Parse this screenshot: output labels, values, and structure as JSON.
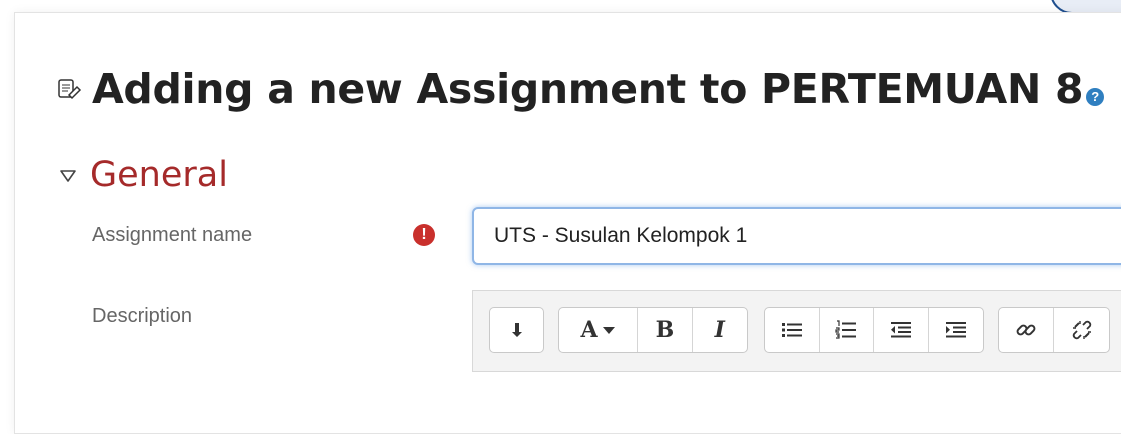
{
  "page": {
    "title": "Adding a new Assignment to PERTEMUAN 8",
    "help_glyph": "?"
  },
  "section": {
    "title": "General"
  },
  "fields": {
    "name": {
      "label": "Assignment name",
      "value": "UTS - Susulan Kelompok 1",
      "required_glyph": "!"
    },
    "description": {
      "label": "Description"
    }
  },
  "toolbar": {
    "font_label": "A",
    "bold_label": "B",
    "italic_label": "I"
  },
  "colors": {
    "section": "#a52a2a",
    "required": "#c9302c",
    "help": "#2f7fc0",
    "focus": "#8fb6e6"
  }
}
